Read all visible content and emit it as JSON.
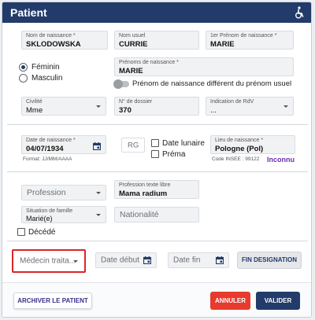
{
  "header": {
    "title": "Patient",
    "icon": "wheelchair-icon"
  },
  "identity": {
    "birth_name": {
      "label": "Nom de naissance *",
      "value": "SKLODOWSKA"
    },
    "usual_name": {
      "label": "Nom usuel",
      "value": "CURRIE"
    },
    "first_given_name": {
      "label": "1er Prénom de naissance *",
      "value": "MARIE"
    },
    "given_names": {
      "label": "Prénoms de naissance *",
      "value": "MARIE"
    },
    "sex_female": "Féminin",
    "sex_male": "Masculin",
    "sex_selected": "Féminin",
    "toggle_label": "Prénom de naissance différent du prénom usuel",
    "civility": {
      "label": "Civilité",
      "value": "Mme"
    },
    "file_number": {
      "label": "N° de dossier",
      "value": "370"
    },
    "rdv": {
      "label": "Indication de RdV",
      "value": "..."
    }
  },
  "birth": {
    "date": {
      "label": "Date de naissance *",
      "value": "04/07/1934"
    },
    "format_hint": "Format: JJ/MM/AAAA",
    "rg": "RG",
    "lunar_date": "Date lunaire",
    "prema": "Préma",
    "place": {
      "label": "Lieu de naissance *",
      "value": "Pologne (Pol)"
    },
    "insee_hint": "Code INSEE : 99122",
    "insee_status": "Inconnu"
  },
  "social": {
    "profession_placeholder": "Profession",
    "profession_free": {
      "label": "Profession texte libre",
      "value": "Mama radium"
    },
    "family": {
      "label": "Situation de famille",
      "value": "Marié(e)"
    },
    "nationality_placeholder": "Nationalité",
    "deceased": "Décédé"
  },
  "doctor": {
    "treating_placeholder": "Médecin traita...",
    "start_date_placeholder": "Date début",
    "end_date_placeholder": "Date fin",
    "end_designation": "FIN DESIGNATION"
  },
  "footer": {
    "archive": "ARCHIVER LE PATIENT",
    "cancel": "ANNULER",
    "validate": "VALIDER"
  },
  "colors": {
    "header": "#223b6b",
    "cancel": "#e63b2e",
    "validate": "#223b6b",
    "highlight": "#d9262a",
    "insee": "#6a2ea8"
  }
}
